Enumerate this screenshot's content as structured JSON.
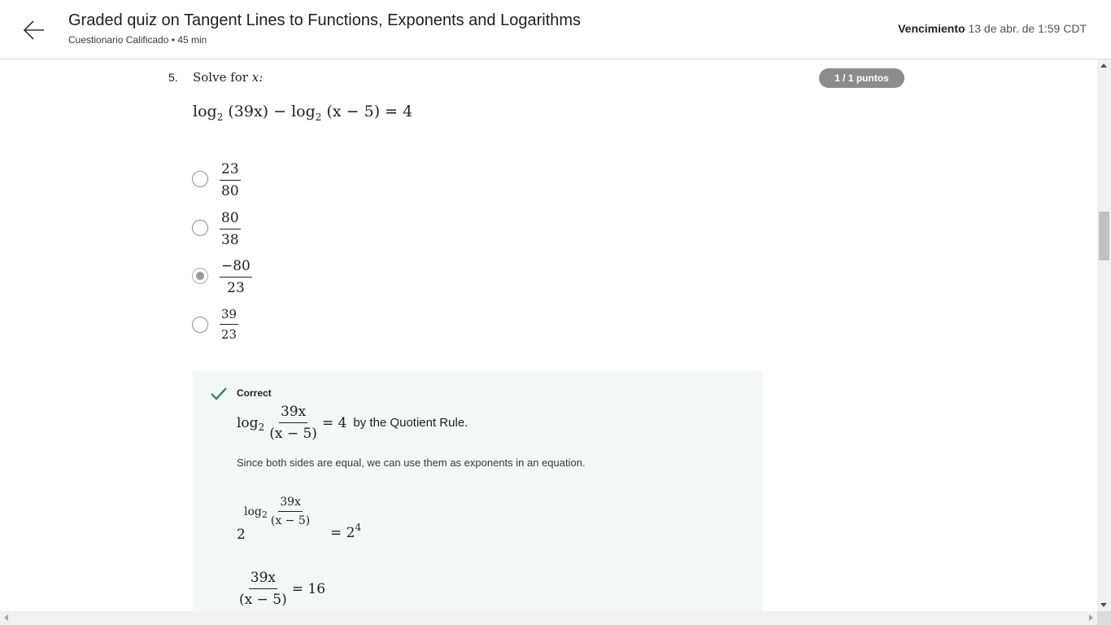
{
  "header": {
    "title": "Graded quiz on Tangent Lines to Functions, Exponents and Logarithms",
    "subtitle": "Cuestionario Calificado • 45 min",
    "due_label": "Vencimiento",
    "due_value": "13 de abr. de 1:59 CDT",
    "back_icon": "arrow-left-icon"
  },
  "question": {
    "number": "5.",
    "prompt_text": "Solve for",
    "prompt_var": "x:",
    "points": "1 / 1 puntos",
    "equation": {
      "log1": "log",
      "base1": "2",
      "arg1": "(39x)",
      "minus": "−",
      "log2": "log",
      "base2": "2",
      "arg2": "(x − 5)",
      "equals": "= 4"
    },
    "options": [
      {
        "numerator": "23",
        "denominator": "80",
        "selected": false
      },
      {
        "numerator": "80",
        "denominator": "38",
        "selected": false
      },
      {
        "numerator": "−80",
        "denominator": "23",
        "selected": true
      },
      {
        "numerator": "39",
        "denominator": "23",
        "selected": false
      }
    ]
  },
  "feedback": {
    "status": "Correct",
    "status_icon": "check-icon",
    "status_color": "#1f8354",
    "step1": {
      "log": "log",
      "base": "2",
      "numerator": "39x",
      "denominator": "(x − 5)",
      "equals": "= 4",
      "text": "by the Quotient Rule."
    },
    "explanation": "Since both sides are equal, we can use them as exponents in an equation.",
    "step2": {
      "base": "2",
      "log": "log",
      "log_base": "2",
      "numerator": "39x",
      "denominator": "(x − 5)",
      "rhs": "= 2",
      "rhs_exp": "4"
    },
    "step3": {
      "numerator": "39x",
      "denominator": "(x − 5)",
      "equals": "= 16"
    }
  }
}
